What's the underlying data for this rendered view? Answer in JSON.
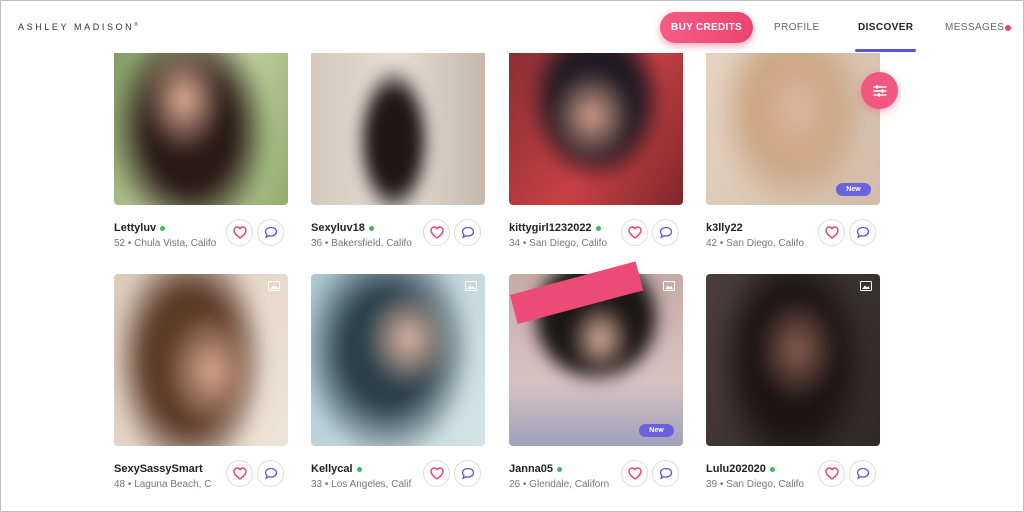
{
  "header": {
    "logo": "ASHLEY MADISON",
    "logo_mark": "®",
    "buy_credits": "BUY CREDITS",
    "nav": {
      "profile": "PROFILE",
      "discover": "DISCOVER",
      "messages": "MESSAGES"
    },
    "active_tab": "DISCOVER"
  },
  "colors": {
    "accent": "#ec4471",
    "nav_active": "#5b55d8",
    "online": "#3fb760",
    "new_badge": "#6b63dd"
  },
  "filter_button_icon": "sliders-icon",
  "profiles": [
    {
      "name": "Lettyluv",
      "meta": "52 • Chula Vista, Califo",
      "online": true,
      "new": false,
      "gallery": false
    },
    {
      "name": "Sexyluv18",
      "meta": "36 • Bakersfield, Califo",
      "online": true,
      "new": false,
      "gallery": false
    },
    {
      "name": "kittygirl1232022",
      "meta": "34 • San Diego, Califo",
      "online": true,
      "new": false,
      "gallery": false
    },
    {
      "name": "k3lly22",
      "meta": "42 • San Diego, Califo",
      "online": false,
      "new": true,
      "new_label": "New",
      "gallery": false
    },
    {
      "name": "SexySassySmart",
      "meta": "48 • Laguna Beach, C",
      "online": false,
      "new": false,
      "gallery": true
    },
    {
      "name": "Kellycal",
      "meta": "33 • Los Angeles, Calif",
      "online": true,
      "new": false,
      "gallery": true
    },
    {
      "name": "Janna05",
      "meta": "26 • Glendale, Californ",
      "online": true,
      "new": true,
      "new_label": "New",
      "gallery": true
    },
    {
      "name": "Lulu202020",
      "meta": "39 • San Diego, Califo",
      "online": true,
      "new": false,
      "gallery": true
    }
  ],
  "action_icons": {
    "like": "heart-icon",
    "message": "chat-bubble-icon"
  }
}
